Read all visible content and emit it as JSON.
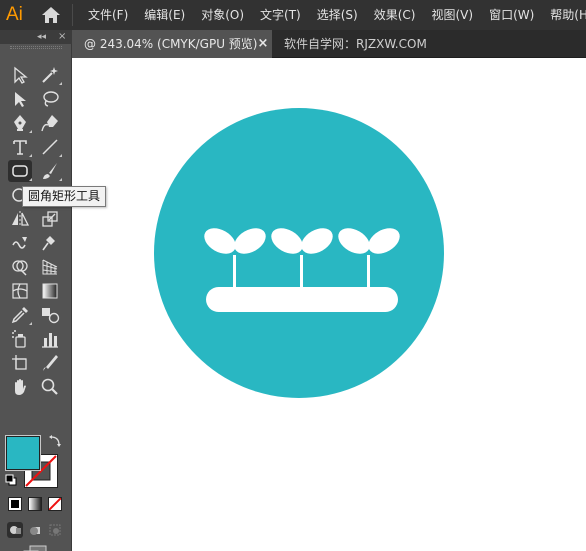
{
  "app": {
    "logo_text": "Ai",
    "accent": "#ff9a00"
  },
  "menu": {
    "items": [
      "文件(F)",
      "编辑(E)",
      "对象(O)",
      "文字(T)",
      "选择(S)",
      "效果(C)",
      "视图(V)",
      "窗口(W)",
      "帮助(H)"
    ]
  },
  "tabs": {
    "active_label": "@ 243.04% (CMYK/GPU 预览)",
    "close_glyph": "×",
    "inactive_label": "软件自学网：RJZXW.COM"
  },
  "toolbar": {
    "collapse_glyph": "◂◂",
    "close_glyph": "×",
    "tooltip": "圆角矩形工具",
    "tools": [
      "selection-tool-icon",
      "magic-wand-icon",
      "direct-selection-icon",
      "lasso-icon",
      "pen-tool-icon",
      "curvature-tool-icon",
      "type-tool-icon",
      "line-segment-icon",
      "rounded-rectangle-tool-icon",
      "paintbrush-icon",
      "shaper-tool-icon",
      "pencil-icon",
      "reflect-tool-icon",
      "scale-tool-icon",
      "warp-tool-icon",
      "puppet-warp-icon",
      "shape-builder-icon",
      "perspective-grid-icon",
      "mesh-tool-icon",
      "gradient-tool-icon",
      "eyedropper-icon",
      "blend-tool-icon",
      "symbol-sprayer-icon",
      "column-graph-icon",
      "artboard-tool-icon",
      "slice-tool-icon",
      "hand-tool-icon",
      "zoom-tool-icon"
    ]
  },
  "colors": {
    "fill": "#29b7c2",
    "stroke": "none",
    "artwork_circle": "#29b7c2",
    "artwork_shapes": "#ffffff"
  }
}
